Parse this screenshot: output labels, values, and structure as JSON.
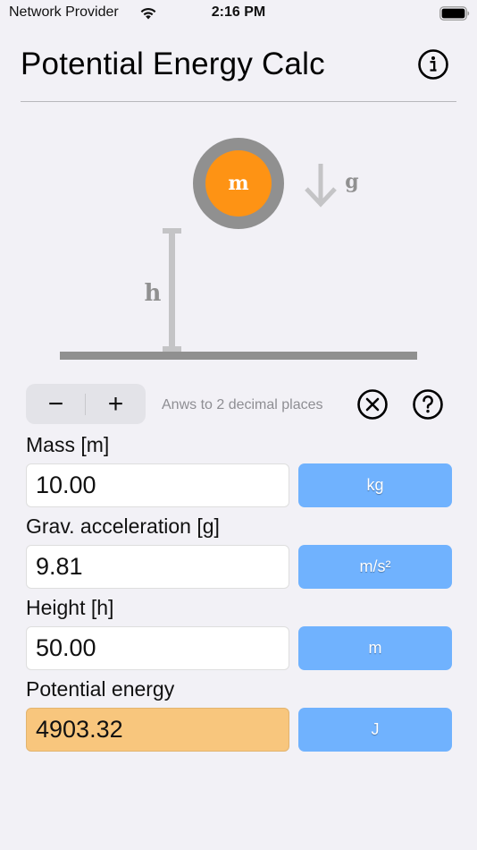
{
  "status_bar": {
    "carrier": "Network Provider",
    "time": "2:16 PM",
    "wifi_icon": "wifi-icon",
    "battery_icon": "battery-full-icon"
  },
  "header": {
    "title": "Potential Energy Calc",
    "info_icon": "info-circle-icon"
  },
  "diagram": {
    "mass_label": "m",
    "gravity_label": "g",
    "height_label": "h",
    "colors": {
      "mass_fill": "#fe9314",
      "mass_ring": "#909090",
      "arrow": "#c4c4c6",
      "height_bar": "#c4c4c6",
      "ground": "#909090",
      "label": "#909090"
    }
  },
  "controls": {
    "decrement_label": "−",
    "increment_label": "+",
    "precision_text": "Anws to 2 decimal places",
    "clear_icon": "xmark-circle-icon",
    "help_icon": "question-circle-icon"
  },
  "fields": [
    {
      "label": "Mass [m]",
      "value": "10.00",
      "unit": "kg"
    },
    {
      "label": "Grav. acceleration [g]",
      "value": "9.81",
      "unit": "m/s²"
    },
    {
      "label": "Height [h]",
      "value": "50.00",
      "unit": "m"
    },
    {
      "label": "Potential energy",
      "value": "4903.32",
      "unit": "J"
    }
  ],
  "colors": {
    "background": "#f2f1f6",
    "unit_button": "#70b2fe",
    "result_field": "#f8c67d",
    "accent_orange": "#fe9314"
  }
}
